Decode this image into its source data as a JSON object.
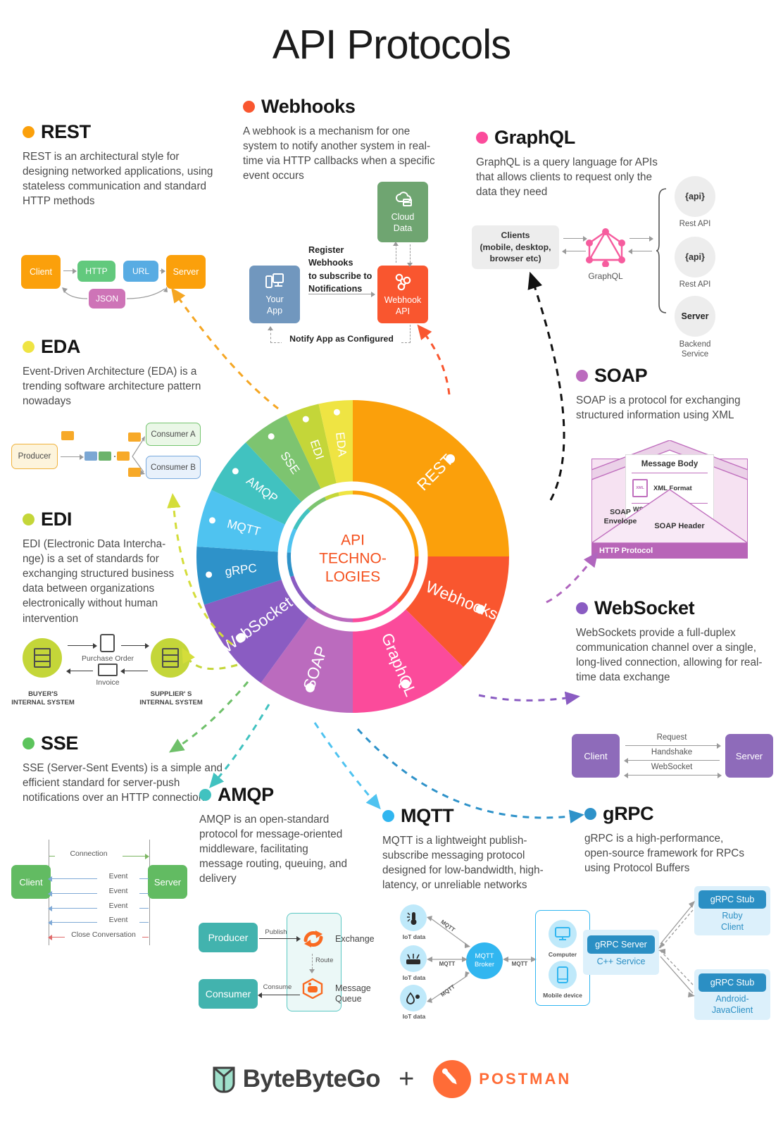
{
  "title": "API Protocols",
  "wheel": {
    "center_lines": [
      "API",
      "TECHNO-",
      "LOGIES"
    ],
    "center_color": "#F4511E",
    "segments": [
      {
        "label": "REST",
        "color": "#FBA00B",
        "value": 25.0
      },
      {
        "label": "Webhooks",
        "color": "#F9562F",
        "value": 12.5
      },
      {
        "label": "GraphQL",
        "color": "#FB4B9B",
        "value": 12.5
      },
      {
        "label": "SOAP",
        "color": "#BB6BBE",
        "value": 10.0
      },
      {
        "label": "WebSocket",
        "color": "#8A5CC2",
        "value": 10.0
      },
      {
        "label": "gRPC",
        "color": "#2E92C9",
        "value": 6.0
      },
      {
        "label": "MQTT",
        "color": "#4FC3F0",
        "value": 6.0
      },
      {
        "label": "AMQP",
        "color": "#41C2C0",
        "value": 6.0
      },
      {
        "label": "SSE",
        "color": "#7DC470",
        "value": 5.0
      },
      {
        "label": "EDI",
        "color": "#C4D639",
        "value": 3.5
      },
      {
        "label": "EDA",
        "color": "#EFE443",
        "value": 3.5
      }
    ]
  },
  "sections": {
    "rest": {
      "name": "REST",
      "dot": "#FBA00B",
      "desc": "REST is an architectural style for designing networked applications, using stateless communication and standard HTTP methods",
      "diagram": {
        "client": "Client",
        "http": "HTTP",
        "url": "URL",
        "server": "Server",
        "json": "JSON"
      }
    },
    "webhooks": {
      "name": "Webhooks",
      "dot": "#F9562F",
      "desc": "A webhook is a mechanism for one system to notify another system in real-time via HTTP callbacks when a specific event occurs",
      "diagram": {
        "cloud_data": "Cloud\nData",
        "cloud_data_l1": "Cloud",
        "cloud_data_l2": "Data",
        "your_app_l1": "Your",
        "your_app_l2": "App",
        "webhook_api_l1": "Webhook",
        "webhook_api_l2": "API",
        "register": "Register\nWebhooks\nto subscribe to\nNotifications",
        "register_l1": "Register",
        "register_l2": "Webhooks",
        "register_l3": "to subscribe to",
        "register_l4": "Notifications",
        "notify": "Notify App as Configured"
      }
    },
    "graphql": {
      "name": "GraphQL",
      "dot": "#FB4B9B",
      "desc": "GraphQL is a query language for APIs that allows clients to request only the data they need",
      "diagram": {
        "clients_l1": "Clients",
        "clients_l2": "(mobile, desktop,",
        "clients_l3": "browser etc)",
        "graphql_label": "GraphQL",
        "api1": "{api}",
        "api1_cap": "Rest API",
        "api2": "{api}",
        "api2_cap": "Rest API",
        "server": "Server",
        "server_cap_l1": "Backend",
        "server_cap_l2": "Service"
      }
    },
    "eda": {
      "name": "EDA",
      "dot": "#EFE443",
      "desc": "Event-Driven Architecture (EDA) is a trending software architecture pattern nowadays",
      "diagram": {
        "producer": "Producer",
        "consumer_a": "Consumer A",
        "consumer_b": "Consumer B"
      }
    },
    "edi": {
      "name": "EDI",
      "dot": "#C4D639",
      "desc": "EDI (Electronic Data Interchange) is a set of standards for exchanging structured business data between organizations electronically without human intervention",
      "desc_l1": "EDI (Electronic Data Intercha-",
      "desc_l2": "nge) is a set of standards for",
      "desc_l3": "exchanging structured business",
      "desc_l4": "data between organizations",
      "desc_l5": "electronically without human",
      "desc_l6": "intervention",
      "diagram": {
        "purchase_order": "Purchase Order",
        "invoice": "Invoice",
        "buyer_l1": "BUYER'S",
        "buyer_l2": "INTERNAL SYSTEM",
        "supplier_l1": "SUPPLIER' S",
        "supplier_l2": "INTERNAL SYSTEM"
      }
    },
    "soap": {
      "name": "SOAP",
      "dot": "#BB6BBE",
      "desc": "SOAP is a protocol for exchanging structured information using XML",
      "diagram": {
        "message_body": "Message Body",
        "xml_badge": "XML",
        "xml_format": "XML Format",
        "wsdl": "WSDL",
        "envelope_l1": "SOAP",
        "envelope_l2": "Envelope",
        "soap_header": "SOAP Header",
        "http_protocol": "HTTP Protocol"
      }
    },
    "websocket": {
      "name": "WebSocket",
      "dot": "#8A5CC2",
      "desc": "WebSockets provide a full-duplex communication channel over a single, long-lived connection, allowing for real-time data exchange",
      "diagram": {
        "client": "Client",
        "server": "Server",
        "request": "Request",
        "handshake": "Handshake",
        "websocket": "WebSocket"
      }
    },
    "sse": {
      "name": "SSE",
      "dot": "#5CC45C",
      "desc": "SSE (Server-Sent Events) is a simple and efficient standard for server-push notifications over an HTTP connection",
      "diagram": {
        "client": "Client",
        "server": "Server",
        "connection": "Connection",
        "events": [
          "Event",
          "Event",
          "Event",
          "Event"
        ],
        "close": "Close Conversation"
      }
    },
    "amqp": {
      "name": "AMQP",
      "dot": "#41C2C0",
      "desc": "AMQP is an open-standard protocol for message-oriented middleware, facilitating message routing, queuing, and delivery",
      "diagram": {
        "producer": "Producer",
        "consumer": "Consumer",
        "publish": "Publish",
        "route": "Route",
        "consume": "Consume",
        "exchange": "Exchange",
        "message_queue_l1": "Message",
        "message_queue_l2": "Queue"
      }
    },
    "mqtt": {
      "name": "MQTT",
      "dot": "#31B6F0",
      "desc": "MQTT is a lightweight publish-subscribe messaging protocol designed for low-bandwidth, high-latency, or unreliable networks",
      "diagram": {
        "broker_l1": "MQTT",
        "broker_l2": "Broker",
        "iot_1": "IoT data",
        "iot_2": "IoT data",
        "iot_3": "IoT data",
        "mqtt_edge": "MQTT",
        "computer": "Computer",
        "mobile": "Mobile device"
      }
    },
    "grpc": {
      "name": "gRPC",
      "dot": "#2E92C9",
      "desc": "gRPC is a high-performance, open-source framework for RPCs using Protocol Buffers",
      "diagram": {
        "server": "gRPC Server",
        "server_sub": "C++ Service",
        "stub1": "gRPC Stub",
        "stub1_l1": "Ruby",
        "stub1_l2": "Client",
        "stub2": "gRPC Stub",
        "stub2_l1": "Android-",
        "stub2_l2": "JavaClient"
      }
    }
  },
  "footer": {
    "brand": "ByteByteGo",
    "plus": "+",
    "partner": "POSTMAN"
  }
}
